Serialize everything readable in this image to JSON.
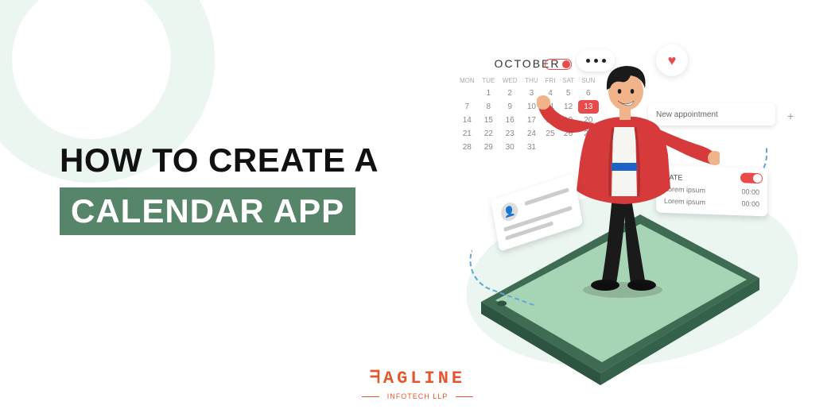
{
  "heading": {
    "line1": "HOW TO CREATE A",
    "line2": "CALENDAR APP"
  },
  "logo": {
    "main": "ᖷAGLINE",
    "sub": "INFOTECH LLP"
  },
  "calendar": {
    "month": "OCTOBER",
    "headers": [
      "MON",
      "TUE",
      "WED",
      "THU",
      "FRI",
      "SAT",
      "SUN"
    ],
    "rows": [
      [
        "",
        "1",
        "2",
        "3",
        "4",
        "5",
        "6"
      ],
      [
        "7",
        "8",
        "9",
        "10",
        "11",
        "12",
        "13"
      ],
      [
        "14",
        "15",
        "16",
        "17",
        "18",
        "19",
        "20"
      ],
      [
        "21",
        "22",
        "23",
        "24",
        "25",
        "26",
        "27"
      ],
      [
        "28",
        "29",
        "30",
        "31",
        "",
        "",
        ""
      ]
    ],
    "highlight": "13"
  },
  "appointment": {
    "label": "New appointment",
    "plus": "+"
  },
  "detail": {
    "title": "DATE",
    "row1_left": "Lorem ipsum",
    "row1_right": "00:00",
    "row2_left": "Lorem ipsum",
    "row2_right": "00:00"
  },
  "icons": {
    "heart": "♥",
    "user": "👤"
  }
}
